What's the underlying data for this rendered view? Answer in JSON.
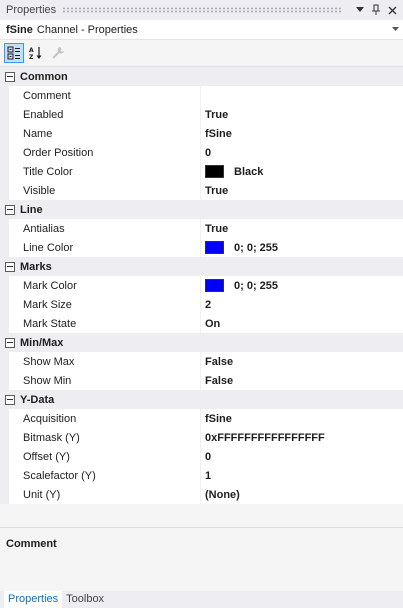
{
  "window": {
    "title": "Properties",
    "pin_glyph": "ₚ",
    "close_glyph": "✕",
    "dropdown_glyph": "▼"
  },
  "object_selector": {
    "name": "fSine",
    "type": "Channel - Properties"
  },
  "toolbar": {
    "categorized_icon": "categorized-view-icon",
    "alphabetical_icon": "sort-alphabetical-icon",
    "property_pages_icon": "wrench-icon"
  },
  "categories": [
    {
      "label": "Common",
      "items": [
        {
          "name": "Comment",
          "value": ""
        },
        {
          "name": "Enabled",
          "value": "True"
        },
        {
          "name": "Name",
          "value": "fSine"
        },
        {
          "name": "Order Position",
          "value": "0"
        },
        {
          "name": "Title Color",
          "value": "Black",
          "swatch": "#000000"
        },
        {
          "name": "Visible",
          "value": "True"
        }
      ]
    },
    {
      "label": "Line",
      "items": [
        {
          "name": "Antialias",
          "value": "True"
        },
        {
          "name": "Line Color",
          "value": "0; 0; 255",
          "swatch": "#0000ff"
        }
      ]
    },
    {
      "label": "Marks",
      "items": [
        {
          "name": "Mark Color",
          "value": "0; 0; 255",
          "swatch": "#0000ff"
        },
        {
          "name": "Mark Size",
          "value": "2"
        },
        {
          "name": "Mark State",
          "value": "On"
        }
      ]
    },
    {
      "label": "Min/Max",
      "items": [
        {
          "name": "Show Max",
          "value": "False"
        },
        {
          "name": "Show Min",
          "value": "False"
        }
      ]
    },
    {
      "label": "Y-Data",
      "items": [
        {
          "name": "Acquisition",
          "value": "fSine"
        },
        {
          "name": "Bitmask (Y)",
          "value": "0xFFFFFFFFFFFFFFFF"
        },
        {
          "name": "Offset (Y)",
          "value": "0"
        },
        {
          "name": "Scalefactor (Y)",
          "value": "1"
        },
        {
          "name": "Unit (Y)",
          "value": "(None)"
        }
      ]
    }
  ],
  "description": {
    "title": "Comment",
    "text": ""
  },
  "tabs": [
    {
      "label": "Properties",
      "active": true
    },
    {
      "label": "Toolbox",
      "active": false
    }
  ]
}
